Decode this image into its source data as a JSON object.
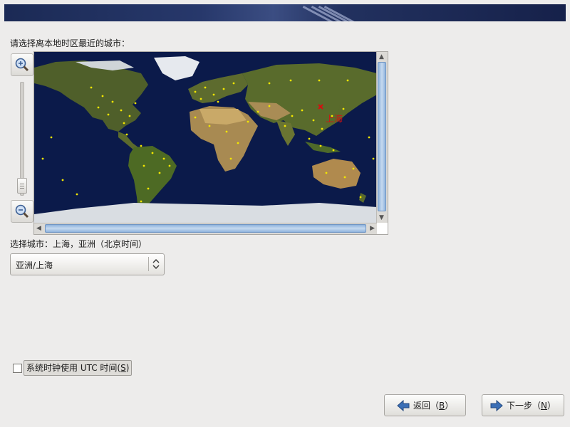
{
  "prompt": "请选择离本地时区最近的城市：",
  "map": {
    "selected_city_label": "上海",
    "colors": {
      "ocean": "#0b1a4a",
      "land": "#5a6b2c",
      "dot": "#f2e600",
      "marker": "#d41010"
    }
  },
  "zoom": {
    "zoom_in_icon": "zoom-in-icon",
    "zoom_out_icon": "zoom-out-icon"
  },
  "selection": {
    "label": "选择城市：",
    "city_text": "上海，亚洲（北京时间）",
    "combo_value": "亚洲/上海"
  },
  "utc": {
    "label_prefix": "系统时钟使用 UTC 时间(",
    "label_key": "S",
    "label_suffix": ")",
    "checked": false
  },
  "buttons": {
    "back_prefix": "返回（",
    "back_key": "B",
    "back_suffix": "）",
    "next_prefix": "下一步（",
    "next_key": "N",
    "next_suffix": "）",
    "accent": "#3b6fb6"
  }
}
